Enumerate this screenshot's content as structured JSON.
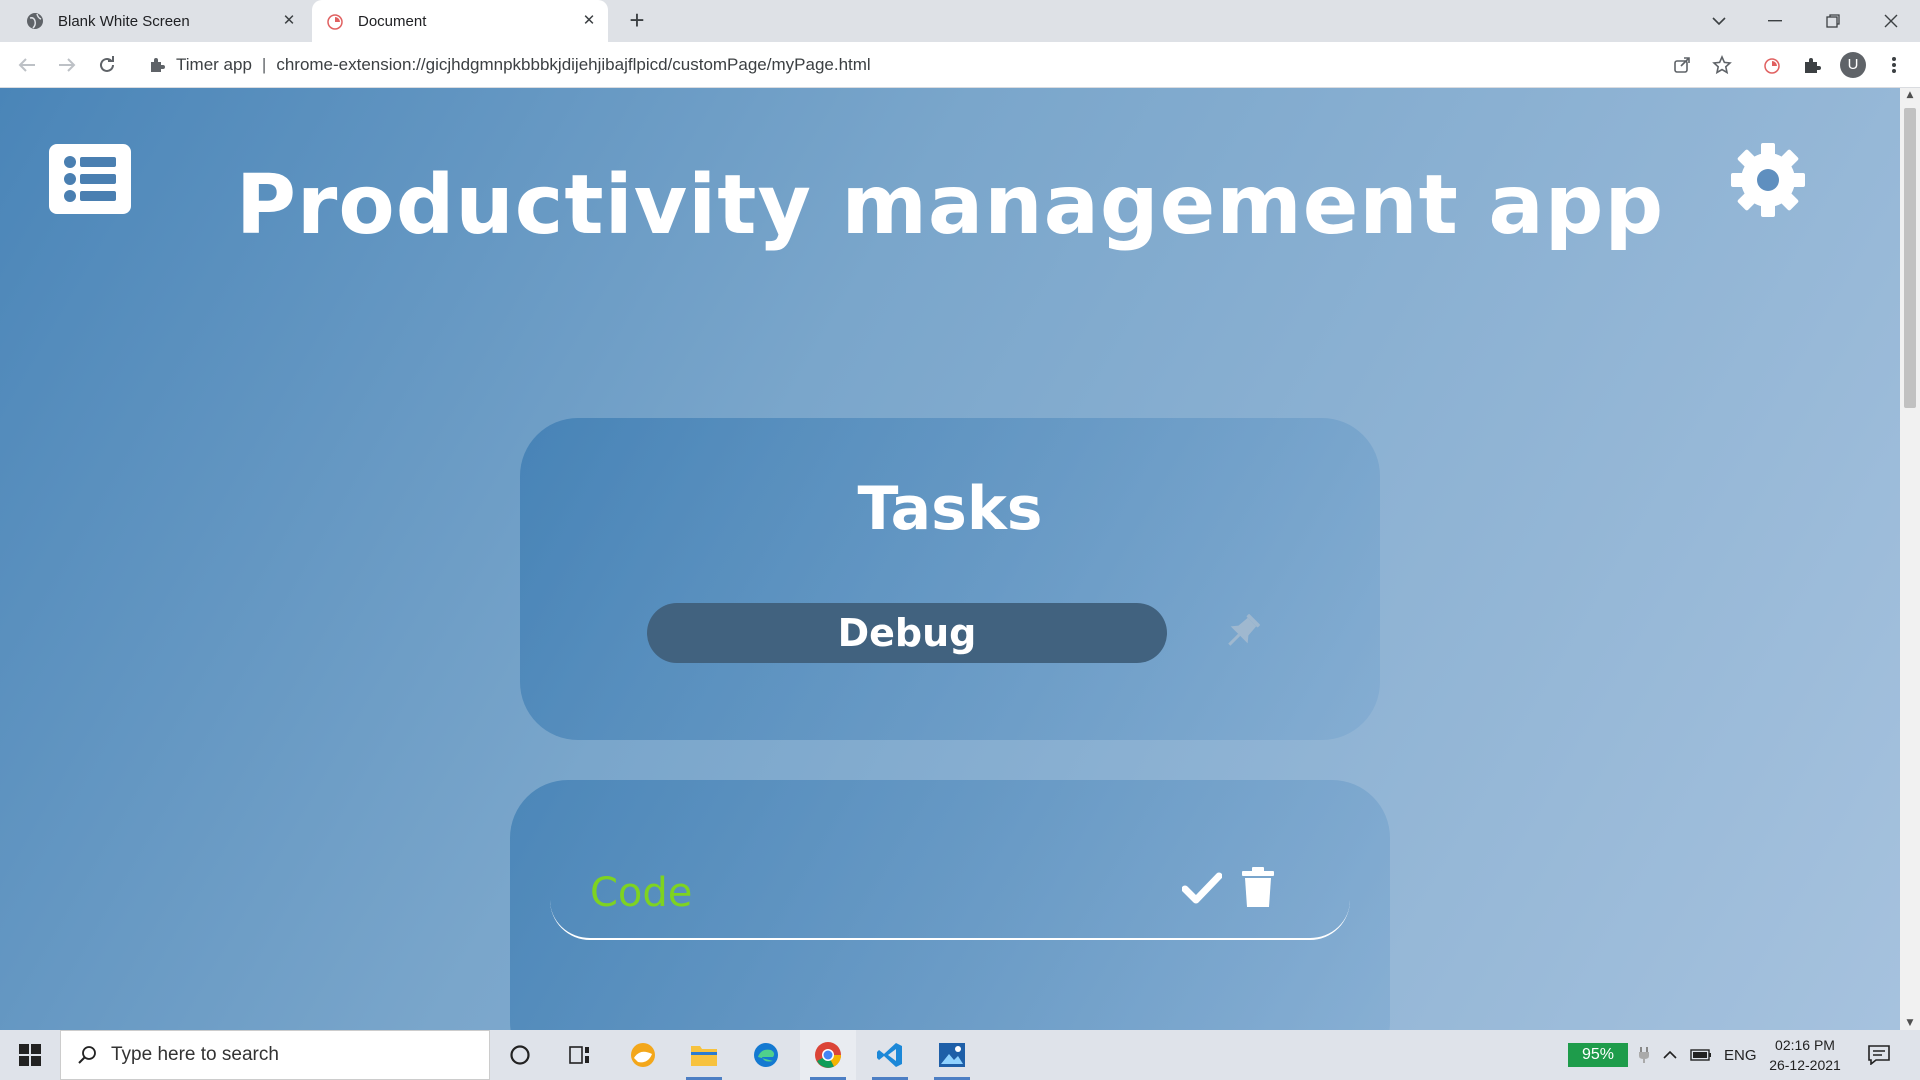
{
  "browser": {
    "tabs": [
      {
        "title": "Blank White Screen",
        "active": false,
        "icon": "globe-icon"
      },
      {
        "title": "Document",
        "active": true,
        "icon": "timer-app-favicon"
      }
    ],
    "site_name": "Timer app",
    "url_separator": "|",
    "url": "chrome-extension://gicjhdgmnpkbbbkjdijehjibajflpicd/customPage/myPage.html",
    "avatar_letter": "U"
  },
  "app": {
    "title": "Productivity management app",
    "tasks_heading": "Tasks",
    "task_input_value": "Debug",
    "tasks": [
      {
        "name": "Code",
        "color": "#7ed321"
      }
    ],
    "colors": {
      "background_start": "#4a85b8",
      "background_end": "#a6c2de",
      "input_bg": "#41627f",
      "task_text": "#7ed321"
    }
  },
  "taskbar": {
    "search_placeholder": "Type here to search",
    "battery_percent": "95%",
    "language": "ENG",
    "time": "02:16 PM",
    "date": "26-12-2021"
  }
}
